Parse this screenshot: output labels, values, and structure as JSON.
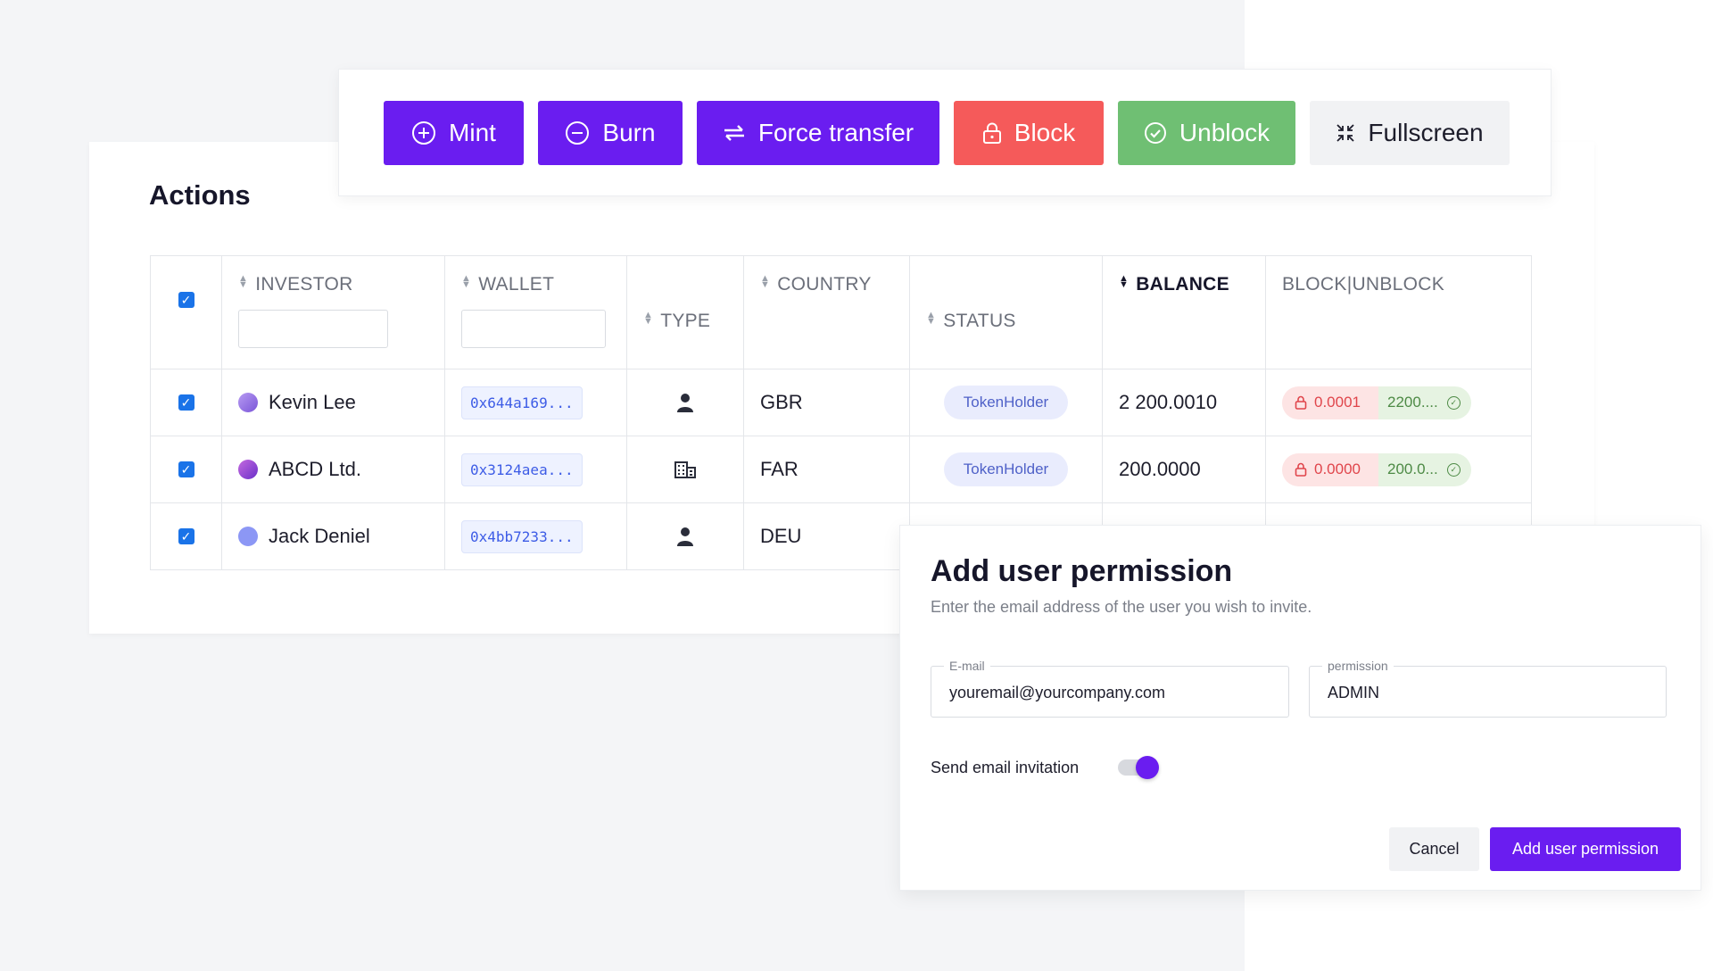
{
  "toolbar": {
    "buttons": [
      {
        "label": "Mint",
        "icon": "plus-circle-icon",
        "color": "#6a1df0"
      },
      {
        "label": "Burn",
        "icon": "minus-circle-icon",
        "color": "#6a1df0"
      },
      {
        "label": "Force transfer",
        "icon": "swap-arrows-icon",
        "color": "#6a1df0"
      },
      {
        "label": "Block",
        "icon": "lock-icon",
        "color": "#f55a5a"
      },
      {
        "label": "Unblock",
        "icon": "check-circle-icon",
        "color": "#6fbf73"
      },
      {
        "label": "Fullscreen",
        "icon": "collapse-icon",
        "color": "#f1f2f4"
      }
    ]
  },
  "actions": {
    "title": "Actions",
    "columns": {
      "investor": "INVESTOR",
      "wallet": "WALLET",
      "type": "TYPE",
      "country": "COUNTRY",
      "status": "STATUS",
      "balance": "BALANCE",
      "block_unblock": "BLOCK|UNBLOCK"
    },
    "sorted_column": "BALANCE",
    "rows": [
      {
        "checked": true,
        "investor": "Kevin Lee",
        "avatar_color": "#9b7be8",
        "wallet": "0x644a169...",
        "type_icon": "person-icon",
        "country": "GBR",
        "status": "TokenHolder",
        "balance": "2 200.0010",
        "blocked": "0.0001",
        "unblocked": "2200...."
      },
      {
        "checked": true,
        "investor": "ABCD Ltd.",
        "avatar_color": "#8e44c9",
        "wallet": "0x3124aea...",
        "type_icon": "building-icon",
        "country": "FAR",
        "status": "TokenHolder",
        "balance": "200.0000",
        "blocked": "0.0000",
        "unblocked": "200.0..."
      },
      {
        "checked": true,
        "investor": "Jack Deniel",
        "avatar_color": "#8c97f5",
        "wallet": "0x4bb7233...",
        "type_icon": "person-icon",
        "country": "DEU",
        "status": "",
        "balance": "",
        "blocked": "",
        "unblocked": ""
      }
    ]
  },
  "dialog": {
    "title": "Add user permission",
    "subtitle": "Enter the email address of the user you wish to invite.",
    "email_label": "E-mail",
    "email_value": "youremail@yourcompany.com",
    "permission_label": "permission",
    "permission_value": "ADMIN",
    "toggle_label": "Send email invitation",
    "toggle_on": true,
    "cancel_label": "Cancel",
    "submit_label": "Add user permission"
  }
}
